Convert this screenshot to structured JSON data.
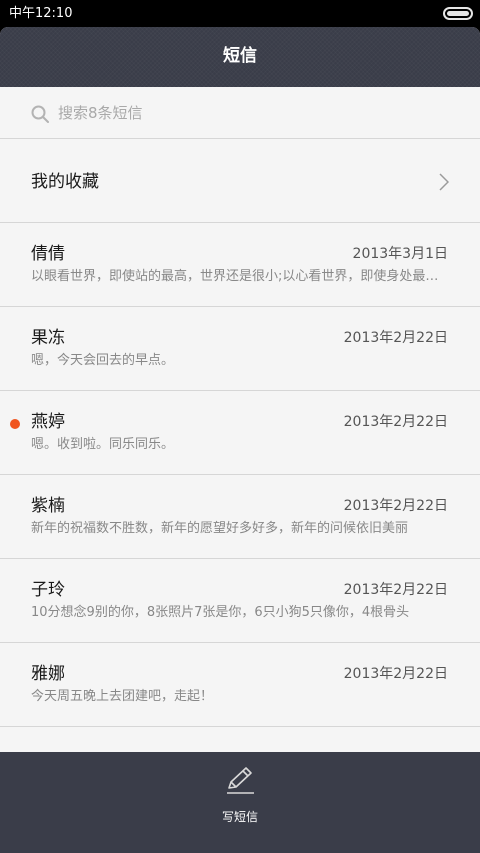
{
  "status_bar": {
    "time": "中午12:10",
    "battery_icon": "battery-icon"
  },
  "header": {
    "title": "短信"
  },
  "search": {
    "placeholder": "搜索8条短信",
    "icon": "search-icon"
  },
  "favorites": {
    "label": "我的收藏",
    "icon": "chevron-right-icon"
  },
  "conversations": [
    {
      "name": "倩倩",
      "date": "2013年3月1日",
      "preview": "以眼看世界，即使站的最高，世界还是很小;以心看世界，即使身处最卑微的地方，世界也会很大",
      "unread": false
    },
    {
      "name": "果冻",
      "date": "2013年2月22日",
      "preview": "嗯，今天会回去的早点。",
      "unread": false
    },
    {
      "name": "燕婷",
      "date": "2013年2月22日",
      "preview": "嗯。收到啦。同乐同乐。",
      "unread": true
    },
    {
      "name": "紫楠",
      "date": "2013年2月22日",
      "preview": "新年的祝福数不胜数，新年的愿望好多好多，新年的问候依旧美丽",
      "unread": false
    },
    {
      "name": "子玲",
      "date": "2013年2月22日",
      "preview": "10分想念9别的你，8张照片7张是你，6只小狗5只像你，4根骨头",
      "unread": false
    },
    {
      "name": "雅娜",
      "date": "2013年2月22日",
      "preview": "今天周五晚上去团建吧，走起！",
      "unread": false
    }
  ],
  "bottom_bar": {
    "compose_label": "写短信",
    "compose_icon": "pencil-icon"
  },
  "colors": {
    "header_bg": "#3a3d49",
    "list_bg": "#f5f5f5",
    "unread_dot": "#f0541e",
    "divider": "#d6d6d6"
  }
}
